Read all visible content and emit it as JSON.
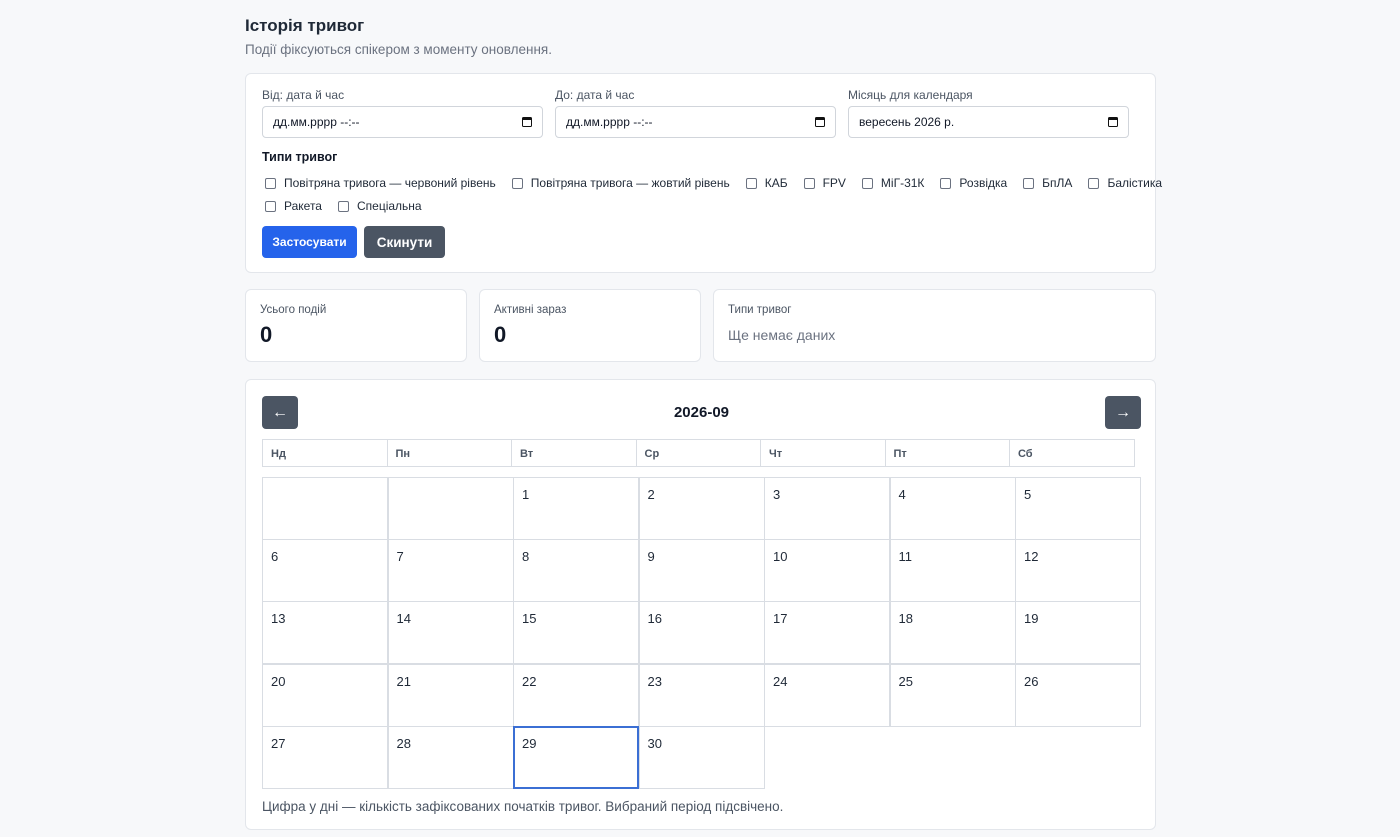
{
  "page": {
    "title": "Історія тривог",
    "subtitle": "Події фіксуються спікером з моменту оновлення."
  },
  "filters": {
    "from_label": "Від: дата й час",
    "from_value": "дд.мм.рррр --:--",
    "to_label": "До: дата й час",
    "to_value": "дд.мм.рррр --:--",
    "month_label": "Місяць для календаря",
    "month_value": "вересень 2026 р.",
    "types_title": "Типи тривог",
    "types_row1": [
      {
        "label": "Повітряна тривога — червоний рівень",
        "checked": false
      },
      {
        "label": "Повітряна тривога — жовтий рівень",
        "checked": false
      },
      {
        "label": "КАБ",
        "checked": false
      },
      {
        "label": "FPV",
        "checked": false
      },
      {
        "label": "МіГ-31К",
        "checked": false
      },
      {
        "label": "Розвідка",
        "checked": false
      },
      {
        "label": "БпЛА",
        "checked": false
      },
      {
        "label": "Балістика",
        "checked": false
      }
    ],
    "types_row2": [
      {
        "label": "Ракета",
        "checked": false
      },
      {
        "label": "Спеціальна",
        "checked": false
      }
    ],
    "apply_label": "Застосувати",
    "reset_label": "Скинути"
  },
  "stats": {
    "total_label": "Усього подій",
    "total_value": "0",
    "active_label": "Активні зараз",
    "active_value": "0",
    "types_label": "Типи тривог",
    "types_empty": "Ще немає даних"
  },
  "calendar": {
    "prev_label": "←",
    "next_label": "→",
    "month_title": "2026-09",
    "weekdays": [
      "Нд",
      "Пн",
      "Вт",
      "Ср",
      "Чт",
      "Пт",
      "Сб"
    ],
    "first_weekday_index": 2,
    "days": [
      "1",
      "2",
      "3",
      "4",
      "5",
      "6",
      "7",
      "8",
      "9",
      "10",
      "11",
      "12",
      "13",
      "14",
      "15",
      "16",
      "17",
      "18",
      "19",
      "20",
      "21",
      "22",
      "23",
      "24",
      "25",
      "26",
      "27",
      "28",
      "29",
      "30"
    ],
    "selected_day": "29",
    "note": "Цифра у дні — кількість зафіксованих початків тривог. Вибраний період підсвічено."
  },
  "colors": {
    "primary": "#2563eb",
    "secondary": "#4b5563",
    "selected_border": "#3b6fd4"
  }
}
